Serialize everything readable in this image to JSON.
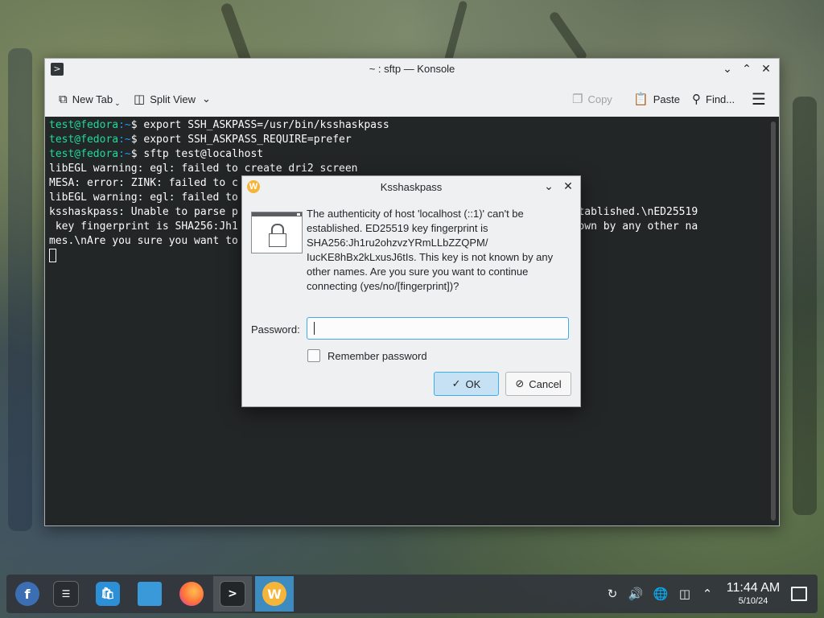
{
  "konsole": {
    "title": "~ : sftp — Konsole",
    "toolbar": {
      "new_tab": "New Tab",
      "split_view": "Split View",
      "copy": "Copy",
      "paste": "Paste",
      "find": "Find..."
    },
    "terminal": {
      "lines": [
        {
          "user": "test@fedora",
          "path": ":~",
          "rest": "$ export SSH_ASKPASS=/usr/bin/ksshaskpass"
        },
        {
          "user": "test@fedora",
          "path": ":~",
          "rest": "$ export SSH_ASKPASS_REQUIRE=prefer"
        },
        {
          "user": "test@fedora",
          "path": ":~",
          "rest": "$ sftp test@localhost"
        },
        {
          "text": "libEGL warning: egl: failed to create dri2 screen"
        },
        {
          "text": "MESA: error: ZINK: failed to c"
        },
        {
          "text": "libEGL warning: egl: failed to"
        },
        {
          "text": "ksshaskpass: Unable to parse p                                              't be established.\\nED25519"
        },
        {
          "text": " key fingerprint is SHA256:Jh1                                              s not known by any other na"
        },
        {
          "text": "mes.\\nAre you sure you want to"
        }
      ]
    }
  },
  "dialog": {
    "title": "Ksshaskpass",
    "message": "The authenticity of host 'localhost (::1)' can't be established. ED25519 key fingerprint is SHA256:Jh1ru2ohzvzYRmLLbZZQPM/ IucKE8hBx2kLxusJ6tIs. This key is not known by any other names. Are you sure you want to continue connecting (yes/no/[fingerprint])?",
    "password_label": "Password:",
    "password_value": "",
    "remember_label": "Remember password",
    "remember_checked": false,
    "ok_label": "OK",
    "cancel_label": "Cancel"
  },
  "taskbar": {
    "apps": [
      "fedora-launcher-icon",
      "system-settings-icon",
      "discover-store-icon",
      "dolphin-files-icon",
      "firefox-icon",
      "konsole-icon",
      "ksshaskpass-icon"
    ],
    "tray": [
      "updates-icon",
      "volume-icon",
      "network-globe-icon",
      "network-wired-icon",
      "tray-expand-icon"
    ],
    "clock": {
      "time": "11:44 AM",
      "date": "5/10/24"
    }
  },
  "colors": {
    "terminal_bg": "#232627",
    "prompt_user": "#1cdc9a",
    "prompt_path": "#1d99f3",
    "accent": "#3daee9",
    "taskbar_bg": "#31363b"
  }
}
